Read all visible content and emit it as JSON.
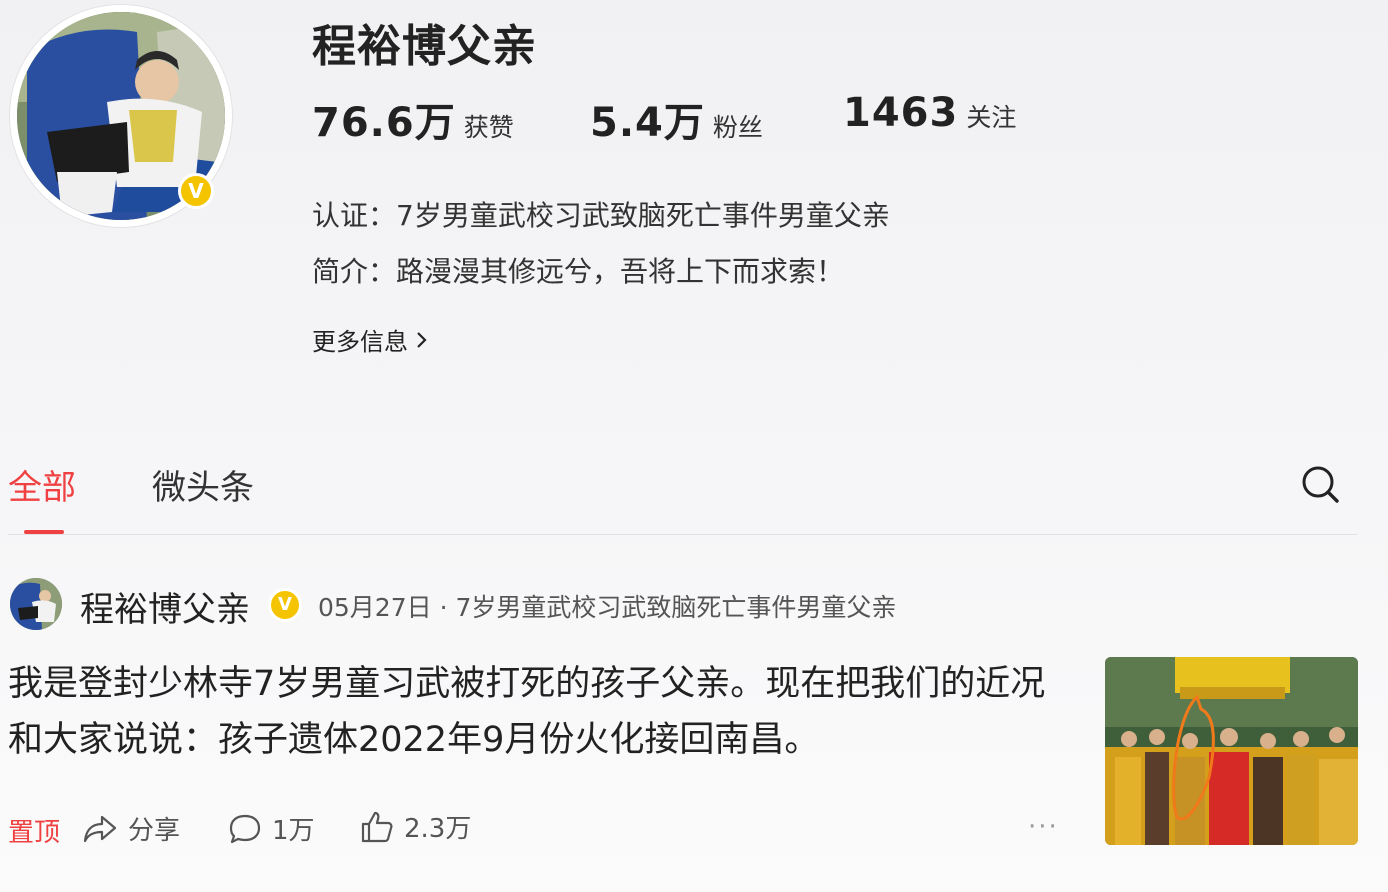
{
  "profile": {
    "name": "程裕博父亲",
    "badge": "V",
    "stats": [
      {
        "value": "76.6万",
        "label": "获赞"
      },
      {
        "value": "5.4万",
        "label": "粉丝"
      },
      {
        "value": "1463",
        "label": "关注"
      }
    ],
    "verification": "认证：7岁男童武校习武致脑死亡事件男童父亲",
    "bio": "简介：路漫漫其修远兮，吾将上下而求索！",
    "more_info": "更多信息",
    "more_info_icon": "chevron-right-icon"
  },
  "tabs": [
    {
      "label": "全部",
      "active": true
    },
    {
      "label": "微头条",
      "active": false
    }
  ],
  "search_icon": "search-icon",
  "post": {
    "author": "程裕博父亲",
    "badge": "V",
    "meta": "05月27日 · 7岁男童武校习武致脑死亡事件男童父亲",
    "text": "我是登封少林寺7岁男童习武被打死的孩子父亲。现在把我们的近况和大家说说：孩子遗体2022年9月份火化接回南昌。",
    "actions": {
      "pinned": "置顶",
      "share": "分享",
      "comments": "1万",
      "likes": "2.3万",
      "more": "···"
    }
  },
  "colors": {
    "accent": "#f04142",
    "verified": "#f5c400",
    "text": "#222222",
    "muted": "#555555"
  }
}
